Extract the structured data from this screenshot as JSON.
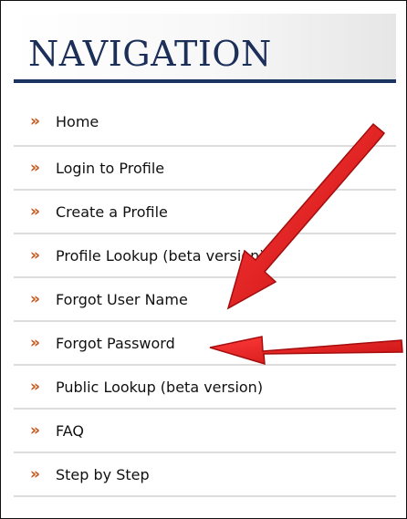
{
  "navigation": {
    "title": "NAVIGATION",
    "bullet_glyph": "»",
    "items": [
      {
        "label": "Home"
      },
      {
        "label": "Login to Profile"
      },
      {
        "label": "Create a Profile"
      },
      {
        "label": "Profile Lookup (beta version)"
      },
      {
        "label": "Forgot User Name"
      },
      {
        "label": "Forgot Password"
      },
      {
        "label": "Public Lookup (beta version)"
      },
      {
        "label": "FAQ"
      },
      {
        "label": "Step by Step"
      }
    ]
  },
  "annotations": {
    "arrow_color": "#e11b1b",
    "arrow_targets": [
      "Forgot User Name",
      "Forgot Password"
    ]
  },
  "colors": {
    "title": "#1b2f58",
    "rule": "#1b3561",
    "bullet": "#c25a1f",
    "divider": "#dcdcdc"
  }
}
